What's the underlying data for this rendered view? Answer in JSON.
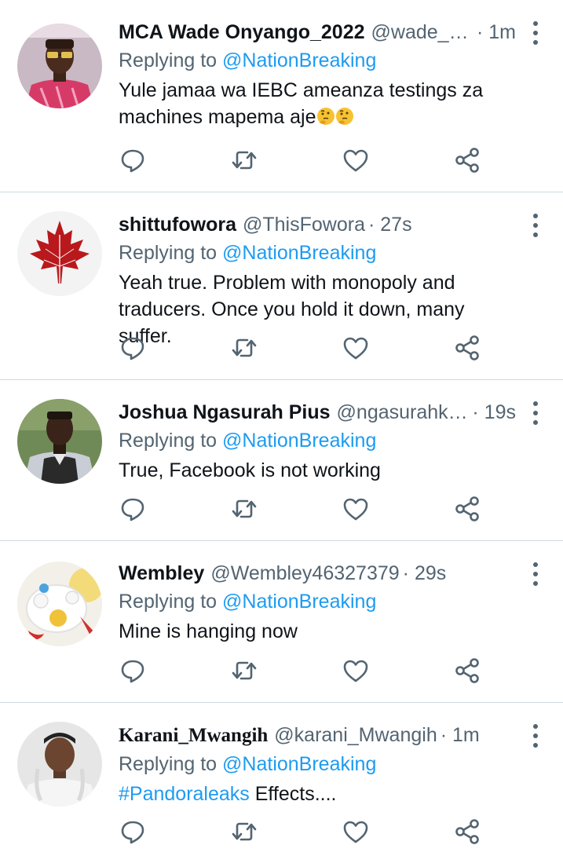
{
  "replies": [
    {
      "name": "MCA Wade Onyango_2022",
      "handle": "@wade_ze...",
      "time": "· 1m",
      "replying_to_prefix": "Replying to ",
      "replying_to": "@NationBreaking",
      "text_lines": [
        "Yule jamaa wa IEBC ameanza testings za",
        "machines mapema aje"
      ],
      "emoji": "thinking-face",
      "avatar_colors": {
        "bg": "#c9b9c4",
        "shirt": "#d63b68"
      }
    },
    {
      "name": "shittufowora",
      "handle": "@ThisFowora",
      "time": "· 27s",
      "replying_to_prefix": "Replying to ",
      "replying_to": "@NationBreaking",
      "text_lines": [
        "Yeah true. Problem with monopoly and",
        "traducers. Once you hold it down, many suffer."
      ],
      "avatar_colors": {
        "bg": "#f3f3f3",
        "leaf": "#b9191c"
      }
    },
    {
      "name": "Joshua Ngasurah Pius",
      "handle": "@ngasurahkp...",
      "time": "· 19s",
      "replying_to_prefix": "Replying to ",
      "replying_to": "@NationBreaking",
      "text_lines": [
        "True, Facebook is not working"
      ],
      "avatar_colors": {
        "bg": "#6f8a56",
        "shirt": "#2a2a2a"
      }
    },
    {
      "name": "Wembley",
      "handle": "@Wembley46327379",
      "time": "· 29s",
      "replying_to_prefix": "Replying to ",
      "replying_to": "@NationBreaking",
      "text_lines": [
        "Mine is hanging now"
      ],
      "avatar_colors": {
        "bg": "#f2f0e8",
        "accent": "#f0c23a"
      }
    },
    {
      "name": "Karani_Mwangih",
      "handle": "@karani_Mwangih",
      "time": "· 1m",
      "replying_to_prefix": "Replying to ",
      "replying_to": "@NationBreaking",
      "hashtag": "#Pandoraleaks",
      "text_after_hashtag": " Effects....",
      "avatar_colors": {
        "bg": "#e6e6e6",
        "skin": "#6b4530"
      }
    }
  ],
  "icons": {
    "reply": "reply-icon",
    "retweet": "retweet-icon",
    "like": "like-icon",
    "share": "share-icon",
    "more": "more-options-icon"
  },
  "colors": {
    "link": "#1d9bf0",
    "secondary": "#536471",
    "divider": "#cfd9de"
  }
}
